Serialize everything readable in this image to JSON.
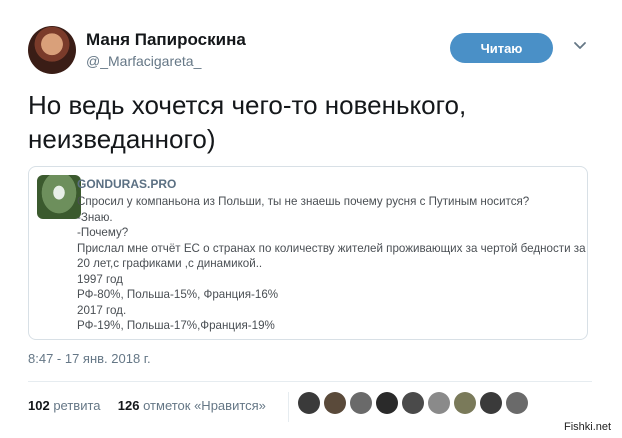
{
  "author": {
    "name": "Маня Папироскина",
    "handle": "@_Marfacigareta_"
  },
  "follow_button": {
    "label": "Читаю"
  },
  "tweet": {
    "text_lines": [
      "Но ведь хочется чего-то новенького,",
      "неизведанного)"
    ]
  },
  "quote": {
    "source": "GONDURAS.PRO",
    "lines": [
      "Спросил у компаньона из Польши, ты не знаешь почему русня с Путиным носится?",
      "-Знаю.",
      "-Почему?",
      "Прислал мне отчёт ЕС о странах по количеству жителей проживающих за чертой бедности за",
      "20 лет,с графиками ,с динамикой..",
      "1997 год",
      "РФ-80%, Польша-15%, Франция-16%",
      "2017 год.",
      "РФ-19%, Польша-17%,Франция-19%"
    ]
  },
  "timestamp": "8:47 - 17 янв. 2018 г.",
  "stats": {
    "retweets_count": "102",
    "retweets_label": "ретвита",
    "likes_count": "126",
    "likes_label": "отметок «Нравится»"
  },
  "likers_colors": [
    "#3a3a3a",
    "#5a4a3a",
    "#6a6a6a",
    "#2a2a2a",
    "#4a4a4a",
    "#8a8a8a",
    "#7a7a5a",
    "#3a3a3a",
    "#6a6a6a"
  ],
  "watermark": "Fishki.net",
  "icons": {
    "more": "chevron-down-icon"
  }
}
